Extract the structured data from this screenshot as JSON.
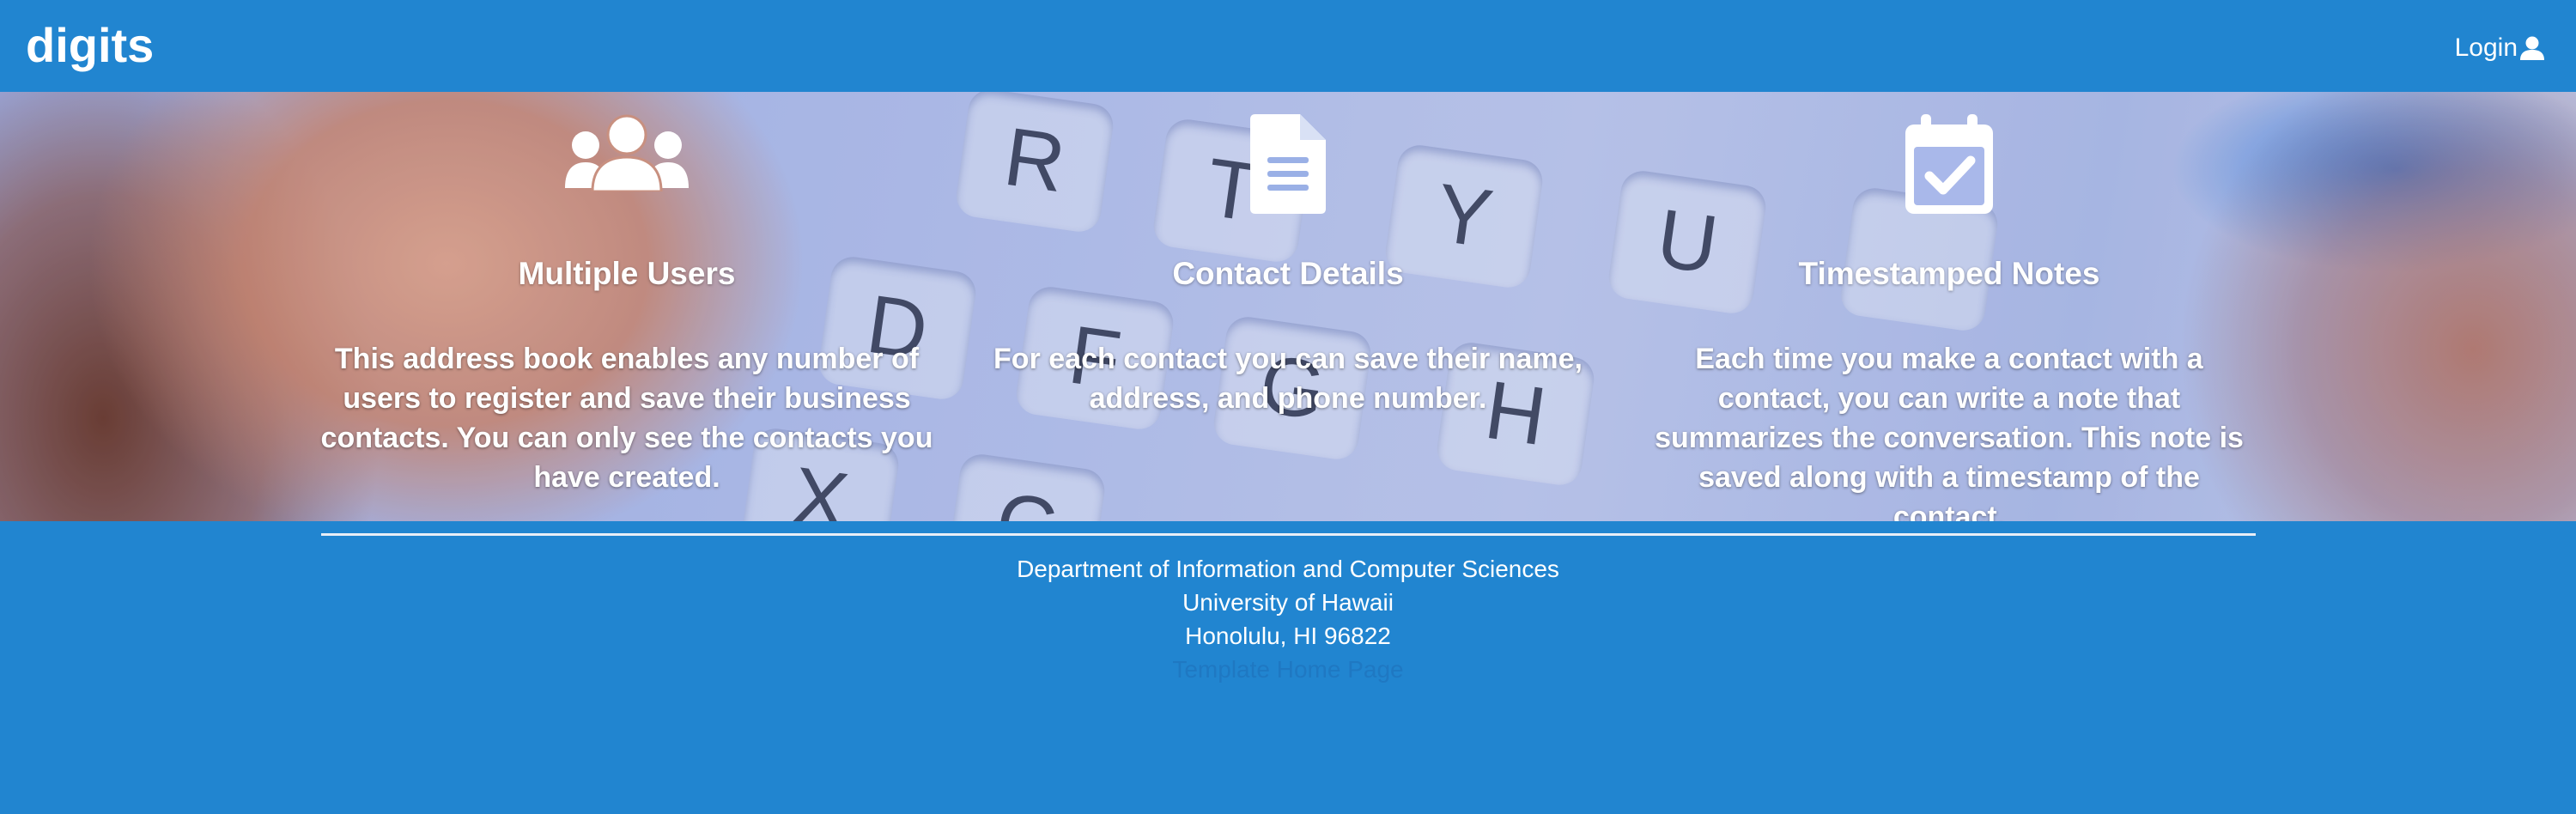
{
  "navbar": {
    "brand": "digits",
    "login_label": "Login",
    "login_icon": "user-icon"
  },
  "features": [
    {
      "icon": "users-icon",
      "title": "Multiple Users",
      "text": "This address book enables any number of users to register and save their business contacts. You can only see the contacts you have created."
    },
    {
      "icon": "file-text-icon",
      "title": "Contact Details",
      "text": "For each contact you can save their name, address, and phone number."
    },
    {
      "icon": "calendar-check-icon",
      "title": "Timestamped Notes",
      "text": "Each time you make a contact with a contact, you can write a note that summarizes the conversation. This note is saved along with a timestamp of the contact."
    }
  ],
  "footer": {
    "line1": "Department of Information and Computer Sciences",
    "line2": "University of Hawaii",
    "line3": "Honolulu, HI 96822",
    "link": "Template Home Page"
  },
  "colors": {
    "primary": "#2185d0",
    "text": "#ffffff",
    "footer_link": "#1f78c2"
  }
}
